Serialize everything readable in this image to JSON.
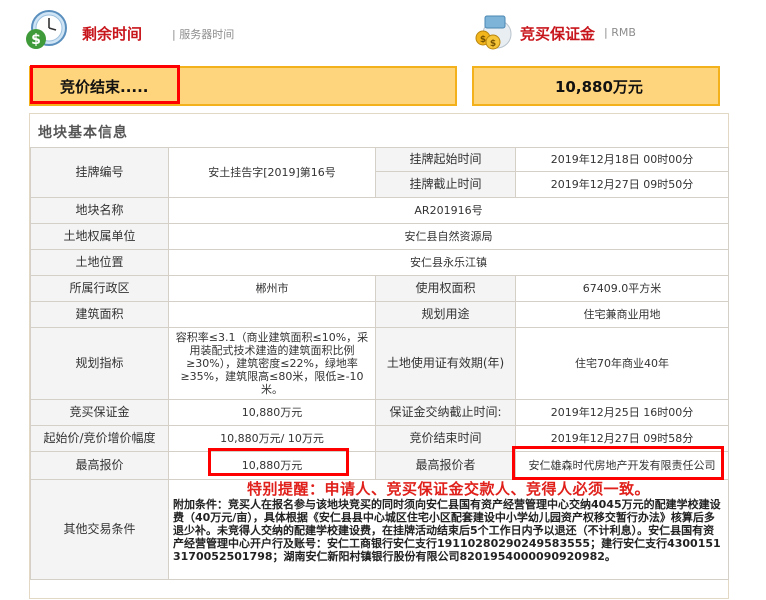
{
  "header": {
    "remaining_label": "剩余时间",
    "server_time_label": "| 服务器时间",
    "deposit_label": "竞买保证金",
    "deposit_unit": "| RMB",
    "status_text": "竞价结束.....",
    "deposit_amount": "10,880万元",
    "icons": [
      "clock-money-icon",
      "money-bags-icon"
    ],
    "colors": {
      "accent_red": "#c8161d",
      "box_fill": "#fed47c",
      "box_border": "#f3b21c",
      "highlight_red": "#ff0000"
    }
  },
  "section": {
    "title": "地块基本信息"
  },
  "table": {
    "listing_no_key": "挂牌编号",
    "listing_no_val": "安土挂告字[2019]第16号",
    "listing_start_key": "挂牌起始时间",
    "listing_start_val": "2019年12月18日 00时00分",
    "listing_end_key": "挂牌截止时间",
    "listing_end_val": "2019年12月27日 09时50分",
    "parcel_name_key": "地块名称",
    "parcel_name_val": "AR201916号",
    "owner_key": "土地权属单位",
    "owner_val": "安仁县自然资源局",
    "location_key": "土地位置",
    "location_val": "安仁县永乐江镇",
    "district_key": "所属行政区",
    "district_val": "郴州市",
    "use_area_key": "使用权面积",
    "use_area_val": "67409.0平方米",
    "build_area_key": "建筑面积",
    "build_area_val": "",
    "purpose_key": "规划用途",
    "purpose_val": "住宅兼商业用地",
    "plan_key": "规划指标",
    "plan_val": "容积率≤3.1（商业建筑面积≤10%，采用装配式技术建造的建筑面积比例≥30%），建筑密度≤22%，绿地率≥35%，建筑限高≤80米，限低≥-10米。",
    "term_key": "土地使用证有效期(年)",
    "term_val": "住宅70年商业40年",
    "deposit_key": "竞买保证金",
    "deposit_val": "10,880万元",
    "deposit_deadline_key": "保证金交纳截止时间:",
    "deposit_deadline_val": "2019年12月25日 16时00分",
    "start_price_key": "起始价/竞价增价幅度",
    "start_price_val": "10,880万元/ 10万元",
    "bid_end_key": "竞价结束时间",
    "bid_end_val": "2019年12月27日 09时58分",
    "top_bid_key": "最高报价",
    "top_bid_val": "10,880万元",
    "top_bidder_key": "最高报价者",
    "top_bidder_val": "安仁雄森时代房地产开发有限责任公司",
    "other_key": "其他交易条件",
    "notice": "特别提醒：申请人、竞买保证金交款人、竞得人必须一致。",
    "conditions": "附加条件：竞买人在报名参与该地块竞买的同时须向安仁县国有资产经营管理中心交纳4045万元的配建学校建设费（40万元/亩），具体根据《安仁县县中心城区住宅小区配套建设中小学幼儿园资产权移交暂行办法》核算后多退少补。未竞得人交纳的配建学校建设费，在挂牌活动结束后5个工作日内予以退还（不计利息）。安仁县国有资产经营管理中心开户行及账号：安仁工商银行安仁支行19110280290249583555；建行安仁支行43001513170052501798；湖南安仁新阳村镇银行股份有限公司8201954000090920982。"
  }
}
